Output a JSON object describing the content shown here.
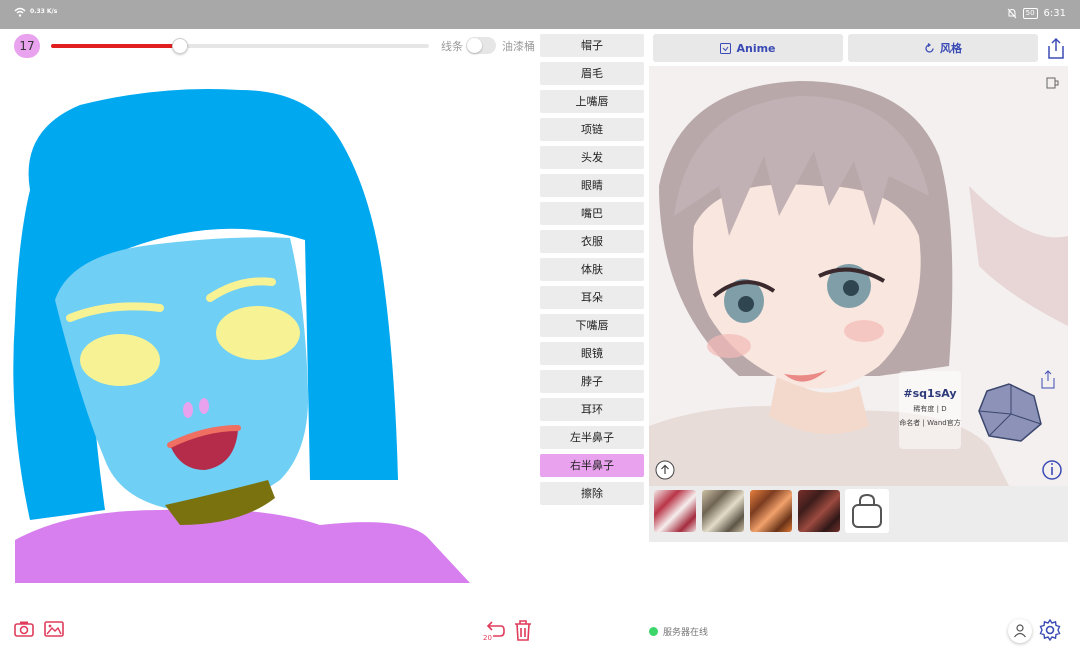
{
  "status_bar": {
    "speed": "0.33 K/s",
    "battery": "50",
    "time": "6:31"
  },
  "brush": {
    "size": "17",
    "slider_fraction": 0.34,
    "mode_line": "线条",
    "mode_paint": "油漆桶",
    "paint_bucket_on": false
  },
  "parts": [
    "帽子",
    "眉毛",
    "上嘴唇",
    "项链",
    "头发",
    "眼睛",
    "嘴巴",
    "衣服",
    "体肤",
    "耳朵",
    "下嘴唇",
    "眼镜",
    "脖子",
    "耳环",
    "左半鼻子",
    "右半鼻子",
    "擦除"
  ],
  "active_part": "右半鼻子",
  "actions": {
    "anime_label": "Anime",
    "style_label": "风格"
  },
  "result": {
    "code": "#sq1sAy",
    "rarity": "稀有度 | D",
    "namer": "命名者 | Wand官方"
  },
  "footer": {
    "undo_count": "20",
    "server_status": "服务器在线"
  },
  "colors": {
    "accent_pink": "#e9a2ee",
    "slider_red": "#e02020",
    "hair_blue": "#00a8f0",
    "skin_blue": "#6fcff5",
    "eye_yellow": "#f7f294",
    "shirt_purple": "#d77fee",
    "necklace_olive": "#7a720e",
    "mouth_red": "#b52c4a",
    "action_blue": "#3b4bb5",
    "online_green": "#3cd66a"
  }
}
